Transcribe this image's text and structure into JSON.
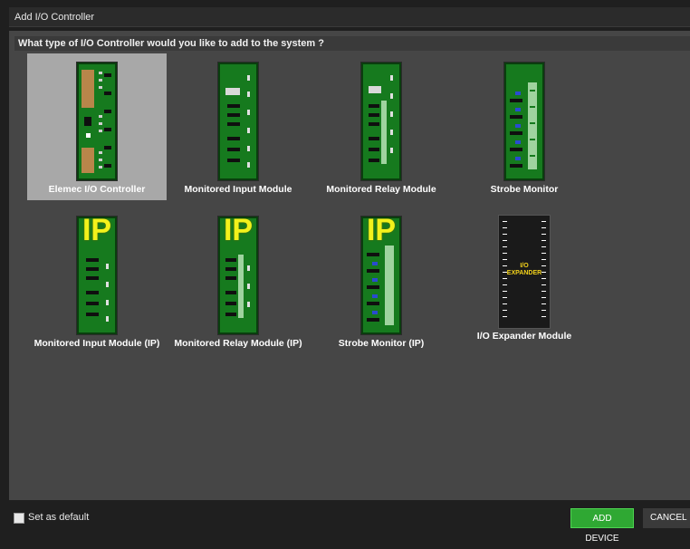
{
  "window": {
    "title": "Add I/O Controller"
  },
  "prompt": "What type of I/O Controller would you like to add to the system ?",
  "modules": [
    {
      "label": "Elemec I/O Controller",
      "selected": true,
      "ip": false
    },
    {
      "label": "Monitored Input Module",
      "selected": false,
      "ip": false
    },
    {
      "label": "Monitored Relay Module",
      "selected": false,
      "ip": false
    },
    {
      "label": "Strobe Monitor",
      "selected": false,
      "ip": false
    },
    {
      "label": "Monitored Input Module (IP)",
      "selected": false,
      "ip": true,
      "badge": "IP"
    },
    {
      "label": "Monitored Relay Module (IP)",
      "selected": false,
      "ip": true,
      "badge": "IP"
    },
    {
      "label": "Strobe Monitor (IP)",
      "selected": false,
      "ip": true,
      "badge": "IP"
    },
    {
      "label": "I/O Expander Module",
      "selected": false,
      "ip": false,
      "chip_text": "I/O\nEXPANDER"
    }
  ],
  "footer": {
    "default_checkbox_label": "Set as default",
    "default_checked": false,
    "add_button": "ADD DEVICE",
    "cancel_button": "CANCEL"
  },
  "colors": {
    "selected_tile": "#a8a8a8",
    "board_green": "#167a1e",
    "ip_badge": "#f3f21b",
    "add_button": "#2fa833"
  }
}
